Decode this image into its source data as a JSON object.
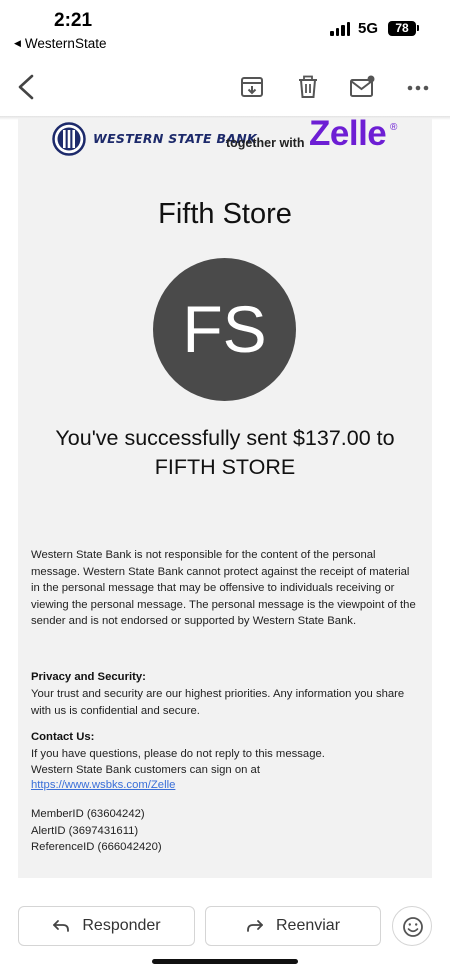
{
  "status_bar": {
    "time": "2:21",
    "back_app": "WesternState",
    "network": "5G",
    "battery": "78"
  },
  "toolbar": {
    "back_icon": "chevron-left-icon",
    "archive_icon": "archive-icon",
    "delete_icon": "trash-icon",
    "unread_icon": "mark-unread-icon",
    "more_icon": "more-horizontal-icon"
  },
  "email": {
    "bank_name": "WESTERN STATE BANK",
    "together_with": "together with",
    "zelle": "Zelle",
    "zelle_reg": "®",
    "payee_name": "Fifth Store",
    "avatar_initials": "FS",
    "success_line_1": "You've successfully sent $137.00 to",
    "success_line_2": "FIFTH STORE",
    "disclaimer": "Western State Bank is not responsible for the content of the personal message. Western State Bank cannot protect against the receipt of material in the personal message that may be offensive to individuals receiving or viewing the personal message. The personal message is the viewpoint of the sender and is not endorsed or supported by Western State Bank.",
    "privacy_title": "Privacy and Security:",
    "privacy_body": "Your trust and security are our highest priorities. Any information you share with us is confidential and secure.",
    "contact_title": "Contact Us:",
    "contact_line_1": "If you have questions, please do not reply to this message.",
    "contact_line_2": "Western State Bank customers can sign on at",
    "contact_link": "https://www.wsbks.com/Zelle",
    "member_id": "MemberID (63604242)",
    "alert_id": "AlertID (3697431611)",
    "reference_id": "ReferenceID (666042420)"
  },
  "actions": {
    "reply_label": "Responder",
    "forward_label": "Reenviar",
    "emoji_icon": "emoji-react-icon"
  },
  "colors": {
    "zelle_purple": "#6d1ed4",
    "bank_navy": "#1d2a6b",
    "avatar_gray": "#4a4a4a",
    "link_blue": "#3a6fd8",
    "card_background": "#f2f2f2"
  }
}
